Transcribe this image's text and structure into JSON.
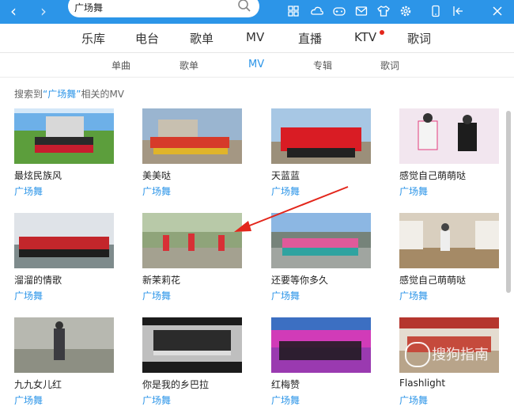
{
  "search": {
    "value": "广场舞"
  },
  "top_nav": {
    "items": [
      "乐库",
      "电台",
      "歌单",
      "MV",
      "直播",
      "KTV",
      "歌词"
    ]
  },
  "sub_nav": {
    "items": [
      "单曲",
      "歌单",
      "MV",
      "专辑",
      "歌词"
    ],
    "active": "MV"
  },
  "result": {
    "prefix": "搜索到",
    "keyword": "“广场舞”",
    "suffix": "相关的MV"
  },
  "cards": [
    {
      "title": "最炫民族风",
      "tag": "广场舞"
    },
    {
      "title": "美美哒",
      "tag": "广场舞"
    },
    {
      "title": "天蓝蓝",
      "tag": "广场舞"
    },
    {
      "title": "感觉自己萌萌哒",
      "tag": "广场舞"
    },
    {
      "title": "溜溜的情歌",
      "tag": "广场舞"
    },
    {
      "title": "新茉莉花",
      "tag": "广场舞"
    },
    {
      "title": "还要等你多久",
      "tag": "广场舞"
    },
    {
      "title": "感觉自己萌萌哒",
      "tag": "广场舞"
    },
    {
      "title": "九九女儿红",
      "tag": "广场舞"
    },
    {
      "title": "你是我的乡巴拉",
      "tag": "广场舞"
    },
    {
      "title": "红梅赞",
      "tag": "广场舞"
    },
    {
      "title": "Flashlight",
      "tag": "广场舞"
    }
  ],
  "watermark": {
    "text": "搜狗指南"
  },
  "colors": {
    "accent": "#2c95e8",
    "badge": "#e3261b"
  },
  "icons": [
    "back-arrow-icon",
    "forward-arrow-icon",
    "search-icon",
    "grid-icon",
    "cloud-icon",
    "gamepad-icon",
    "mail-icon",
    "shirt-icon",
    "gear-icon",
    "phone-icon",
    "mini-mode-icon",
    "close-icon"
  ]
}
